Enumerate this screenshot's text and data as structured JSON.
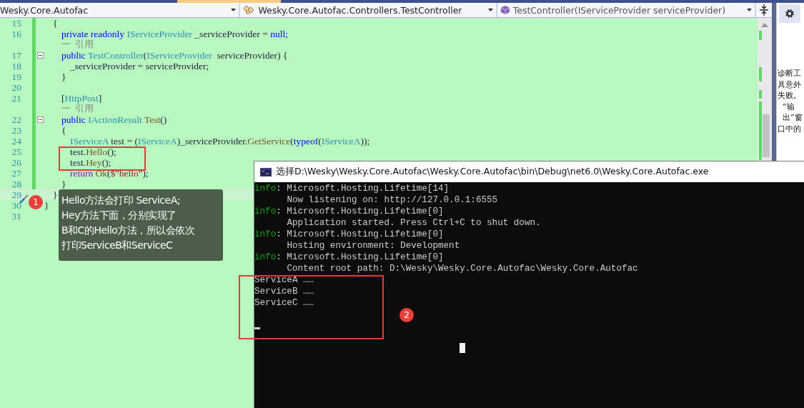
{
  "navigation_bar": {
    "dropdowns": [
      {
        "text": "Wesky.Core.Autofac",
        "kind": "plain"
      },
      {
        "text": "Wesky.Core.Autofac.Controllers.TestController",
        "kind": "class"
      },
      {
        "text": "TestController(IServiceProvider serviceProvider)",
        "kind": "method"
      }
    ]
  },
  "editor": {
    "lines": [
      {
        "kind": "block",
        "children": [
          {
            "kind": "code",
            "number": "15",
            "changed": true,
            "foldable": false,
            "current": false,
            "tokens": [
              {
                "t": "{",
                "kind": "plain"
              }
            ]
          },
          {
            "kind": "block",
            "children": [
              {
                "kind": "code",
                "number": "16",
                "changed": true,
                "foldable": false,
                "current": false,
                "tokens": [
                  {
                    "t": "private readonly ",
                    "kind": "keyword"
                  },
                  {
                    "t": "IServiceProvider",
                    "kind": "type"
                  },
                  {
                    "t": " _serviceProvider = ",
                    "kind": "plain"
                  },
                  {
                    "t": "null",
                    "kind": "keyword"
                  },
                  {
                    "t": ";",
                    "kind": "plain"
                  }
                ]
              },
              {
                "kind": "lens",
                "changed": true,
                "text": "一  引用"
              },
              {
                "kind": "code",
                "number": "17",
                "changed": true,
                "foldable": true,
                "current": false,
                "tokens": [
                  {
                    "t": "public ",
                    "kind": "keyword"
                  },
                  {
                    "t": "TestController",
                    "kind": "type"
                  },
                  {
                    "t": "(",
                    "kind": "plain"
                  },
                  {
                    "t": "IServiceProvider",
                    "kind": "type"
                  },
                  {
                    "t": "  serviceProvider) {",
                    "kind": "plain"
                  }
                ]
              },
              {
                "kind": "block",
                "children": [
                  {
                    "kind": "code",
                    "number": "18",
                    "changed": true,
                    "foldable": false,
                    "current": false,
                    "tokens": [
                      {
                        "t": "_serviceProvider = serviceProvider;",
                        "kind": "plain"
                      }
                    ]
                  }
                ]
              },
              {
                "kind": "code",
                "number": "19",
                "changed": true,
                "foldable": false,
                "current": false,
                "tokens": [
                  {
                    "t": "}",
                    "kind": "plain"
                  }
                ]
              },
              {
                "kind": "code",
                "number": "20",
                "changed": true,
                "foldable": false,
                "current": false
              },
              {
                "kind": "code",
                "number": "21",
                "changed": true,
                "foldable": false,
                "current": false,
                "tokens": [
                  {
                    "t": "[",
                    "kind": "plain"
                  },
                  {
                    "t": "HttpPost",
                    "kind": "type"
                  },
                  {
                    "t": "]",
                    "kind": "plain"
                  }
                ]
              },
              {
                "kind": "lens",
                "changed": true,
                "text": "一  引用"
              },
              {
                "kind": "code",
                "number": "22",
                "changed": true,
                "foldable": true,
                "current": false,
                "tokens": [
                  {
                    "t": "public ",
                    "kind": "keyword"
                  },
                  {
                    "t": "IActionResult ",
                    "kind": "type"
                  },
                  {
                    "t": "Test",
                    "kind": "method"
                  },
                  {
                    "t": "()",
                    "kind": "plain"
                  }
                ]
              },
              {
                "kind": "code",
                "number": "23",
                "changed": true,
                "foldable": false,
                "current": false,
                "tokens": [
                  {
                    "t": "{",
                    "kind": "plain"
                  }
                ]
              },
              {
                "kind": "block",
                "children": [
                  {
                    "kind": "code",
                    "number": "24",
                    "changed": true,
                    "foldable": false,
                    "current": false,
                    "tokens": [
                      {
                        "t": "IServiceA",
                        "kind": "type"
                      },
                      {
                        "t": " test = (",
                        "kind": "plain"
                      },
                      {
                        "t": "IServiceA",
                        "kind": "type"
                      },
                      {
                        "t": ")_serviceProvider.",
                        "kind": "plain"
                      },
                      {
                        "t": "GetService",
                        "kind": "method"
                      },
                      {
                        "t": "(",
                        "kind": "plain"
                      },
                      {
                        "t": "typeof",
                        "kind": "keyword"
                      },
                      {
                        "t": "(",
                        "kind": "plain"
                      },
                      {
                        "t": "IServiceA",
                        "kind": "type"
                      },
                      {
                        "t": "));",
                        "kind": "plain"
                      }
                    ]
                  },
                  {
                    "kind": "code",
                    "number": "25",
                    "changed": true,
                    "foldable": false,
                    "current": false,
                    "tokens": [
                      {
                        "t": "test.",
                        "kind": "plain"
                      },
                      {
                        "t": "Hello",
                        "kind": "method"
                      },
                      {
                        "t": "();",
                        "kind": "plain"
                      }
                    ]
                  },
                  {
                    "kind": "code",
                    "number": "26",
                    "changed": true,
                    "foldable": false,
                    "current": false,
                    "tokens": [
                      {
                        "t": "test.",
                        "kind": "plain"
                      },
                      {
                        "t": "Hey",
                        "kind": "method"
                      },
                      {
                        "t": "();",
                        "kind": "plain"
                      }
                    ]
                  },
                  {
                    "kind": "code",
                    "number": "27",
                    "changed": true,
                    "foldable": false,
                    "current": false,
                    "tokens": [
                      {
                        "t": "return ",
                        "kind": "control"
                      },
                      {
                        "t": "Ok",
                        "kind": "method"
                      },
                      {
                        "t": "(",
                        "kind": "plain"
                      },
                      {
                        "t": "$\"hello\"",
                        "kind": "string"
                      },
                      {
                        "t": ");",
                        "kind": "plain"
                      }
                    ]
                  }
                ]
              },
              {
                "kind": "code",
                "number": "28",
                "changed": true,
                "foldable": false,
                "current": false,
                "tokens": [
                  {
                    "t": "}",
                    "kind": "plain"
                  }
                ]
              }
            ]
          },
          {
            "kind": "code",
            "number": "29",
            "changed": false,
            "foldable": false,
            "current": true,
            "tokens": [
              {
                "t": "}",
                "kind": "plain"
              }
            ]
          }
        ]
      },
      {
        "kind": "code",
        "number": "30",
        "changed": false,
        "foldable": false,
        "current": false,
        "tokens": [
          {
            "t": "}",
            "kind": "plain"
          }
        ]
      },
      {
        "kind": "code",
        "number": "31",
        "changed": false,
        "foldable": false,
        "current": false
      }
    ]
  },
  "callouts": [
    {
      "number": "1",
      "lines": [
        "Hello方法会打印 ServiceA;",
        "Hey方法下面，分别实现了",
        "B和C的Hello方法，所以会依次",
        "打印ServiceB和ServiceC"
      ]
    },
    {
      "number": "2"
    }
  ],
  "console": {
    "title": "选择D:\\Wesky\\Wesky.Core.Autofac\\Wesky.Core.Autofac\\bin\\Debug\\net6.0\\Wesky.Core.Autofac.exe",
    "lines": [
      {
        "kind": "log",
        "prefix": "info",
        "text": ": Microsoft.Hosting.Lifetime[14]"
      },
      {
        "kind": "detail",
        "text": "Now listening on: http://127.0.0.1:6555"
      },
      {
        "kind": "log",
        "prefix": "info",
        "text": ": Microsoft.Hosting.Lifetime[0]"
      },
      {
        "kind": "detail",
        "text": "Application started. Press Ctrl+C to shut down."
      },
      {
        "kind": "log",
        "prefix": "info",
        "text": ": Microsoft.Hosting.Lifetime[0]"
      },
      {
        "kind": "detail",
        "text": "Hosting environment: Development"
      },
      {
        "kind": "log",
        "prefix": "info",
        "text": ": Microsoft.Hosting.Lifetime[0]"
      },
      {
        "kind": "detail",
        "text": "Content root path: D:\\Wesky\\Wesky.Core.Autofac\\Wesky.Core.Autofac"
      },
      {
        "kind": "plain",
        "text": "ServiceA ……"
      },
      {
        "kind": "plain",
        "text": "ServiceB ……"
      },
      {
        "kind": "plain",
        "text": "ServiceC ……"
      }
    ]
  },
  "side_panel": {
    "text_lines": [
      "诊断工",
      "具意外",
      "失败。",
      "  “输",
      "  出”窗",
      "口中的"
    ]
  }
}
